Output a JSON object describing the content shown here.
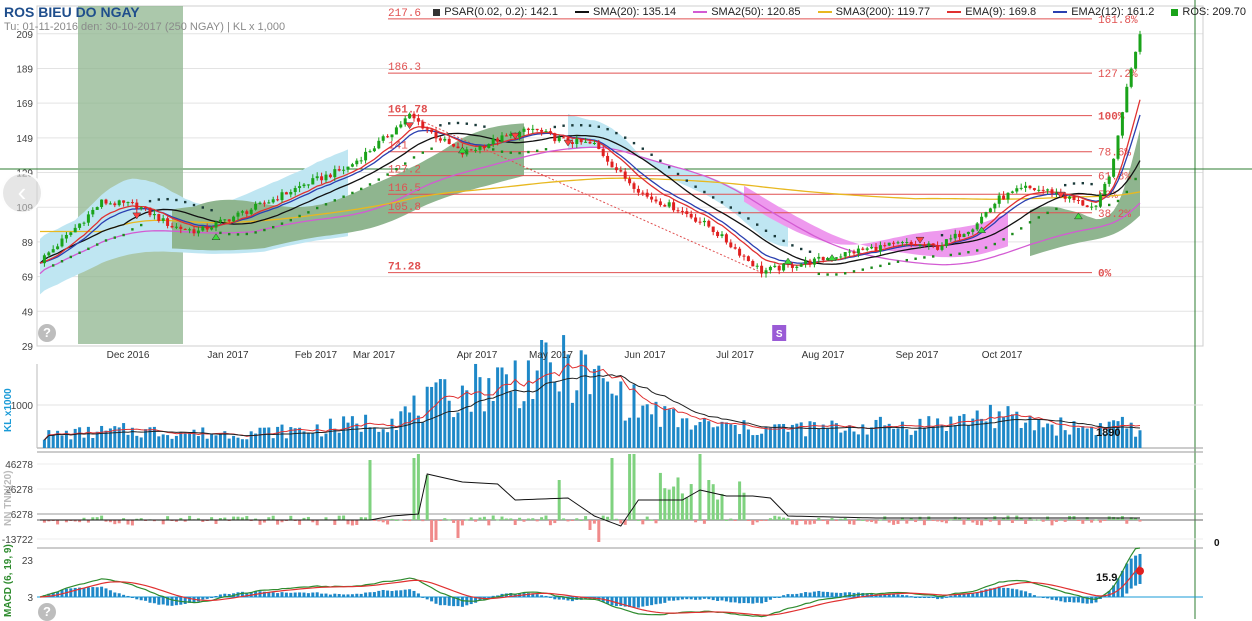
{
  "header": {
    "title": "ROS BIEU DO NGAY",
    "subtitle": "Tu: 01-11-2016 den: 30-10-2017 (250 NGAY) | KL x 1,000"
  },
  "legend": [
    {
      "label": "PSAR(0.02, 0.2): 142.1",
      "color": "#333333",
      "kind": "square"
    },
    {
      "label": "SMA(20): 135.14",
      "color": "#111111",
      "kind": "line"
    },
    {
      "label": "SMA2(50): 120.85",
      "color": "#d35bd3",
      "kind": "line"
    },
    {
      "label": "SMA3(200): 119.77",
      "color": "#e8b820",
      "kind": "line"
    },
    {
      "label": "EMA(9): 169.8",
      "color": "#e03030",
      "kind": "line"
    },
    {
      "label": "EMA2(12): 161.2",
      "color": "#2a3fb0",
      "kind": "line"
    },
    {
      "label": "ROS: 209.70",
      "color": "#1aa31a",
      "kind": "square"
    }
  ],
  "nav": {
    "back_glyph": "‹",
    "help_glyph": "?"
  },
  "chart_data": [
    {
      "type": "candlestick",
      "panel": "price",
      "ylim": [
        29,
        225
      ],
      "yticks": [
        29,
        49,
        69,
        89,
        109,
        129,
        149,
        169,
        189,
        209
      ],
      "xlabels": [
        "Dec 2016",
        "Jan 2017",
        "Feb 2017",
        "Mar 2017",
        "Apr 2017",
        "May 2017",
        "Jun 2017",
        "Jul 2017",
        "Aug 2017",
        "Sep 2017",
        "Oct 2017"
      ],
      "close_anchors": [
        [
          0,
          78
        ],
        [
          6,
          92
        ],
        [
          14,
          112
        ],
        [
          22,
          110
        ],
        [
          30,
          98
        ],
        [
          36,
          95
        ],
        [
          50,
          110
        ],
        [
          60,
          122
        ],
        [
          70,
          132
        ],
        [
          78,
          148
        ],
        [
          84,
          161.8
        ],
        [
          90,
          150
        ],
        [
          96,
          140
        ],
        [
          104,
          148
        ],
        [
          112,
          154
        ],
        [
          118,
          148
        ],
        [
          126,
          145
        ],
        [
          132,
          128
        ],
        [
          138,
          115
        ],
        [
          145,
          108
        ],
        [
          152,
          98
        ],
        [
          158,
          85
        ],
        [
          164,
          72
        ],
        [
          168,
          74
        ],
        [
          176,
          78
        ],
        [
          186,
          84
        ],
        [
          196,
          88
        ],
        [
          204,
          86
        ],
        [
          212,
          98
        ],
        [
          218,
          114
        ],
        [
          224,
          120
        ],
        [
          230,
          118
        ],
        [
          236,
          112
        ],
        [
          240,
          108
        ],
        [
          244,
          135
        ],
        [
          246,
          165
        ],
        [
          248,
          190
        ],
        [
          250,
          209.7
        ]
      ],
      "fibonacci": [
        {
          "value": 217.6,
          "label": "217.6",
          "pct": "161.8%"
        },
        {
          "value": 186.3,
          "label": "186.3",
          "pct": "127.2%"
        },
        {
          "value": 161.78,
          "label": "161.78",
          "pct": "100%"
        },
        {
          "value": 141,
          "label": "141",
          "pct": "78.6%"
        },
        {
          "value": 127.2,
          "label": "127.2",
          "pct": "61.8%"
        },
        {
          "value": 116.5,
          "label": "116.5",
          "pct": "50%"
        },
        {
          "value": 105.8,
          "label": "105.8",
          "pct": "38.2%"
        },
        {
          "value": 71.28,
          "label": "71.28",
          "pct": "0%"
        }
      ],
      "crosshair": {
        "value": 131
      },
      "event_marker": {
        "label": "S",
        "day": 168
      }
    },
    {
      "type": "bar",
      "panel": "volume",
      "ylabel": "KL x1000",
      "ytick_label": "1000",
      "last_value_label": "1890",
      "anchors": [
        [
          0,
          300
        ],
        [
          20,
          420
        ],
        [
          40,
          340
        ],
        [
          60,
          420
        ],
        [
          70,
          540
        ],
        [
          80,
          700
        ],
        [
          90,
          1100
        ],
        [
          100,
          1500
        ],
        [
          110,
          1700
        ],
        [
          120,
          1900
        ],
        [
          126,
          1600
        ],
        [
          136,
          1000
        ],
        [
          146,
          600
        ],
        [
          160,
          460
        ],
        [
          180,
          480
        ],
        [
          200,
          560
        ],
        [
          210,
          660
        ],
        [
          216,
          820
        ],
        [
          222,
          640
        ],
        [
          232,
          520
        ],
        [
          242,
          480
        ],
        [
          246,
          680
        ],
        [
          250,
          300
        ]
      ]
    },
    {
      "type": "bar",
      "panel": "ntnn",
      "ylabel": "NN TNN(20)",
      "yticks": [
        "46278",
        "26278",
        "6278",
        "-13722"
      ],
      "right_label": "0"
    },
    {
      "type": "bar",
      "panel": "macd",
      "ylabel": "MACD (6, 19, 9)",
      "yticks": [
        "23",
        "3"
      ],
      "last_value_label": "15.9"
    }
  ]
}
